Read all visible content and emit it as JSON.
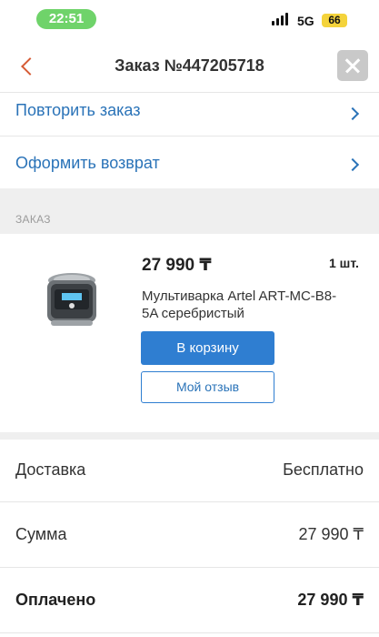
{
  "status_bar": {
    "time": "22:51",
    "network": "5G",
    "battery": "66"
  },
  "header": {
    "title": "Заказ №447205718"
  },
  "actions": {
    "repeat_order": "Повторить заказ",
    "make_return": "Оформить возврат"
  },
  "order_section": {
    "label": "ЗАКАЗ"
  },
  "item": {
    "price": "27 990 ₸",
    "quantity": "1 шт.",
    "name": "Мультиварка Artel ART-MC-B8-5A серебристый",
    "cart_button": "В корзину",
    "review_button": "Мой отзыв"
  },
  "summary": {
    "delivery_label": "Доставка",
    "delivery_value": "Бесплатно",
    "sum_label": "Сумма",
    "sum_value": "27 990 ₸",
    "paid_label": "Оплачено",
    "paid_value": "27 990 ₸"
  },
  "colors": {
    "accent_blue": "#2f7ed1",
    "back_arrow": "#d65b35",
    "time_pill": "#6fd36a",
    "battery": "#f4d33b"
  }
}
